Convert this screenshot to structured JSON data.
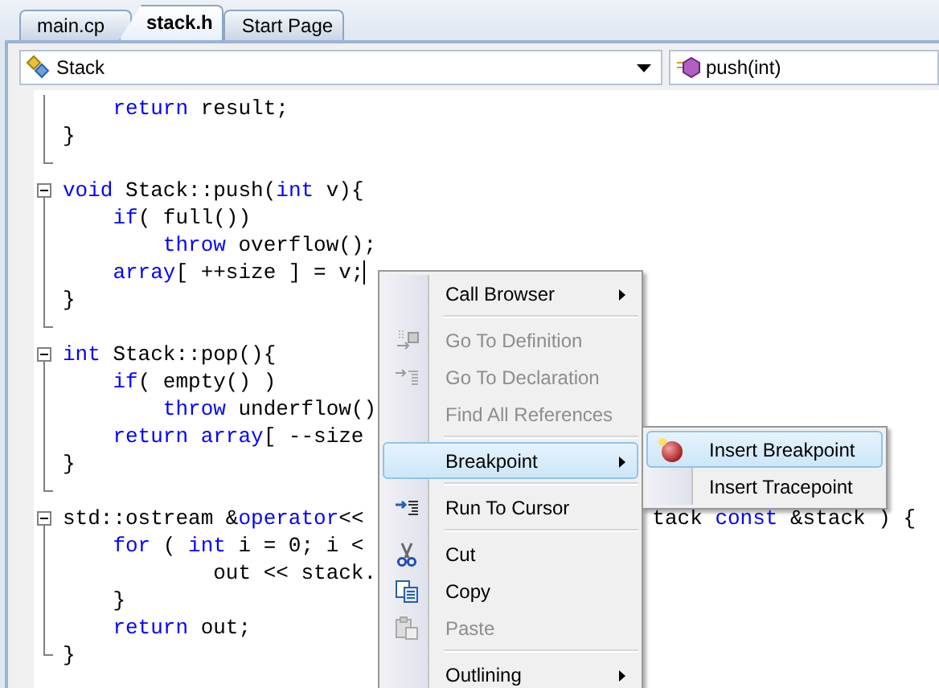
{
  "tabs": [
    {
      "label": "main.cp",
      "selected": false
    },
    {
      "label": "stack.h",
      "selected": true
    },
    {
      "label": "Start Page",
      "selected": false
    }
  ],
  "navigation": {
    "type_combo": "Stack",
    "member_combo": "push(int)"
  },
  "code_lines": [
    {
      "kind": "fold_mid",
      "segments": [
        {
          "text": "    return",
          "kind": "keyword"
        },
        {
          "text": " result;",
          "kind": "plain"
        }
      ]
    },
    {
      "kind": "fold_mid",
      "segments": [
        {
          "text": "}",
          "kind": "plain"
        }
      ]
    },
    {
      "kind": "fold_end"
    },
    {
      "kind": "fold_start",
      "segments": [
        {
          "text": "void",
          "kind": "keyword"
        },
        {
          "text": " Stack::push(",
          "kind": "plain"
        },
        {
          "text": "int",
          "kind": "keyword"
        },
        {
          "text": " v){",
          "kind": "plain"
        }
      ]
    },
    {
      "kind": "fold_mid",
      "segments": [
        {
          "text": "    if",
          "kind": "keyword"
        },
        {
          "text": "( full())",
          "kind": "plain"
        }
      ]
    },
    {
      "kind": "fold_mid",
      "segments": [
        {
          "text": "        throw",
          "kind": "keyword"
        },
        {
          "text": " overflow();",
          "kind": "plain"
        }
      ]
    },
    {
      "kind": "fold_mid",
      "caret": true,
      "segments": [
        {
          "text": "    array",
          "kind": "keyword"
        },
        {
          "text": "[ ++size ] = v;",
          "kind": "plain"
        }
      ]
    },
    {
      "kind": "fold_mid",
      "segments": [
        {
          "text": "}",
          "kind": "plain"
        }
      ]
    },
    {
      "kind": "fold_end"
    },
    {
      "kind": "fold_start",
      "segments": [
        {
          "text": "int",
          "kind": "keyword"
        },
        {
          "text": " Stack::pop(){",
          "kind": "plain"
        }
      ]
    },
    {
      "kind": "fold_mid",
      "segments": [
        {
          "text": "    if",
          "kind": "keyword"
        },
        {
          "text": "( empty() )",
          "kind": "plain"
        }
      ]
    },
    {
      "kind": "fold_mid",
      "segments": [
        {
          "text": "        throw",
          "kind": "keyword"
        },
        {
          "text": " underflow()",
          "kind": "plain"
        }
      ]
    },
    {
      "kind": "fold_mid",
      "segments": [
        {
          "text": "    return array",
          "kind": "keyword"
        },
        {
          "text": "[ --size",
          "kind": "plain"
        }
      ]
    },
    {
      "kind": "fold_mid",
      "segments": [
        {
          "text": "}",
          "kind": "plain"
        }
      ]
    },
    {
      "kind": "fold_end"
    },
    {
      "kind": "fold_start",
      "segments": [
        {
          "text": "std::ostream &",
          "kind": "plain"
        },
        {
          "text": "operator",
          "kind": "keyword"
        },
        {
          "text": "<<",
          "kind": "plain"
        }
      ],
      "tail_segments": [
        {
          "text": "tack ",
          "kind": "plain"
        },
        {
          "text": "const",
          "kind": "keyword"
        },
        {
          "text": " &stack ) {",
          "kind": "plain"
        }
      ]
    },
    {
      "kind": "fold_mid",
      "segments": [
        {
          "text": "    for",
          "kind": "keyword"
        },
        {
          "text": " ( ",
          "kind": "plain"
        },
        {
          "text": "int",
          "kind": "keyword"
        },
        {
          "text": " i = 0; i <",
          "kind": "plain"
        }
      ]
    },
    {
      "kind": "fold_mid",
      "segments": [
        {
          "text": "            out << stack.",
          "kind": "plain"
        }
      ]
    },
    {
      "kind": "fold_mid",
      "segments": [
        {
          "text": "    }",
          "kind": "plain"
        }
      ]
    },
    {
      "kind": "fold_mid",
      "segments": [
        {
          "text": "    return",
          "kind": "keyword"
        },
        {
          "text": " out;",
          "kind": "plain"
        }
      ]
    },
    {
      "kind": "fold_end",
      "segments": [
        {
          "text": "}",
          "kind": "plain"
        }
      ]
    }
  ],
  "context_menu": {
    "items": [
      {
        "kind": "item",
        "label": "Call Browser",
        "disabled": false,
        "selected": false,
        "submenu": true
      },
      {
        "kind": "separator"
      },
      {
        "kind": "item",
        "label": "Go To Definition",
        "disabled": true,
        "selected": false,
        "submenu": false
      },
      {
        "kind": "item",
        "label": "Go To Declaration",
        "disabled": true,
        "selected": false,
        "submenu": false
      },
      {
        "kind": "item",
        "label": "Find All References",
        "disabled": true,
        "selected": false,
        "submenu": false
      },
      {
        "kind": "separator"
      },
      {
        "kind": "item",
        "label": "Breakpoint",
        "disabled": false,
        "selected": true,
        "submenu": true
      },
      {
        "kind": "separator"
      },
      {
        "kind": "item",
        "label": "Run To Cursor",
        "disabled": false,
        "selected": false,
        "submenu": false
      },
      {
        "kind": "separator"
      },
      {
        "kind": "item",
        "label": "Cut",
        "disabled": false,
        "selected": false,
        "submenu": false
      },
      {
        "kind": "item",
        "label": "Copy",
        "disabled": false,
        "selected": false,
        "submenu": false
      },
      {
        "kind": "item",
        "label": "Paste",
        "disabled": true,
        "selected": false,
        "submenu": false
      },
      {
        "kind": "separator"
      },
      {
        "kind": "item",
        "label": "Outlining",
        "disabled": false,
        "selected": false,
        "submenu": true
      }
    ]
  },
  "submenu": {
    "items": [
      {
        "label": "Insert Breakpoint",
        "selected": true
      },
      {
        "label": "Insert Tracepoint",
        "selected": false
      }
    ]
  }
}
